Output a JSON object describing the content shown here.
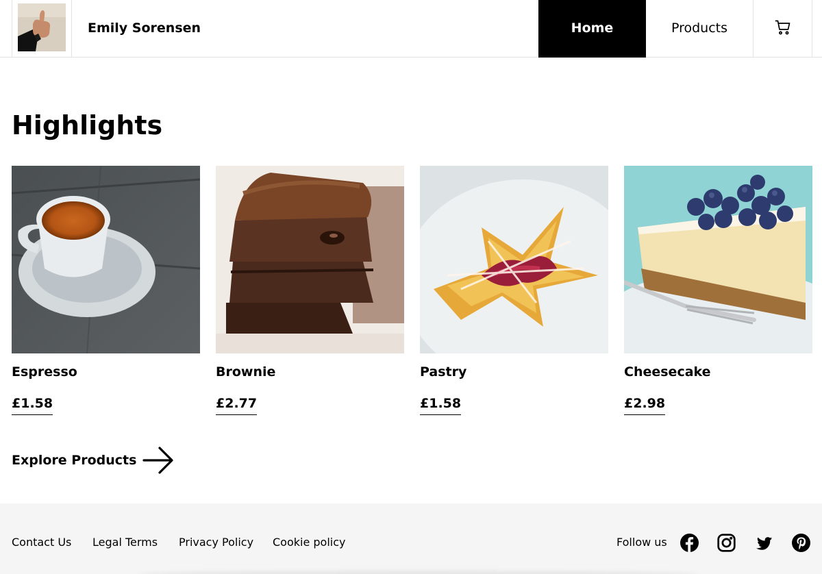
{
  "header": {
    "brand_name": "Emily Sorensen",
    "nav": {
      "home_label": "Home",
      "products_label": "Products"
    },
    "cart_icon": "shopping-cart-icon"
  },
  "main": {
    "section_title": "Highlights",
    "products": [
      {
        "name": "Espresso",
        "price": "£1.58",
        "image": "espresso-cup"
      },
      {
        "name": "Brownie",
        "price": "£2.77",
        "image": "brownie-stack"
      },
      {
        "name": "Pastry",
        "price": "£1.58",
        "image": "fruit-pastry"
      },
      {
        "name": "Cheesecake",
        "price": "£2.98",
        "image": "blueberry-cheesecake"
      }
    ],
    "explore_label": "Explore Products",
    "explore_icon": "arrow-right-icon"
  },
  "footer": {
    "links": [
      "Contact Us",
      "Legal Terms",
      "Privacy Policy",
      "Cookie policy"
    ],
    "follow_label": "Follow us",
    "social_icons": [
      "facebook-icon",
      "instagram-icon",
      "twitter-icon",
      "pinterest-icon"
    ]
  },
  "colors": {
    "active_nav_bg": "#000000",
    "active_nav_text": "#ffffff",
    "footer_bg": "#f5f5f5",
    "border": "#e2e2e2"
  }
}
